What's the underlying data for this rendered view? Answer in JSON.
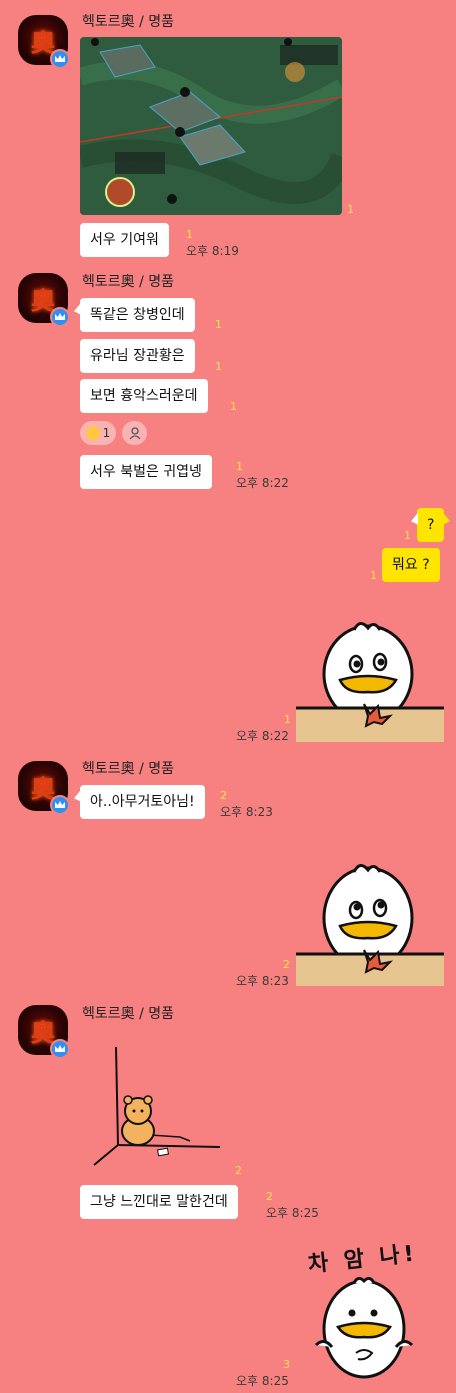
{
  "sender": {
    "name": "헥토르奧 / 명품",
    "avatar_glyph": "奧",
    "avatar_badge": "crown-icon"
  },
  "messages": {
    "m1_photo_unread": "1",
    "m1_text": "서우 기여워",
    "m1_unread": "1",
    "m1_time": "오후 8:19",
    "m2_text_a": "똑같은 창병인데",
    "m2_unread_a": "1",
    "m2_text_b": "유라님 장관황은",
    "m2_unread_b": "1",
    "m2_text_c": "보면 흉악스러운데",
    "m2_unread_c": "1",
    "reaction_count": "1",
    "m2_text_d": "서우 북벌은 귀엽넹",
    "m2_unread_d": "1",
    "m2_time": "오후 8:22",
    "me_a": "?",
    "me_a_unread": "1",
    "me_b": "뭐요 ?",
    "me_b_unread": "1",
    "sticker1_unread": "1",
    "sticker1_time": "오후 8:22",
    "m3_text": "아..아무거토아님!",
    "m3_unread": "2",
    "m3_time": "오후 8:23",
    "sticker2_unread": "2",
    "sticker2_time": "오후 8:23",
    "m4_image_unread": "2",
    "m4_text": "그냥 느낀대로 말한건데",
    "m4_unread": "2",
    "m4_time": "오후 8:25",
    "sticker3_caption": "차 암 나!",
    "sticker3_unread": "3",
    "sticker3_time": "오후 8:25"
  },
  "colors": {
    "background": "#f78181",
    "my_bubble": "#fee500",
    "other_bubble": "#ffffff",
    "unread": "#ffe14a",
    "badge": "#2f8ff2"
  }
}
